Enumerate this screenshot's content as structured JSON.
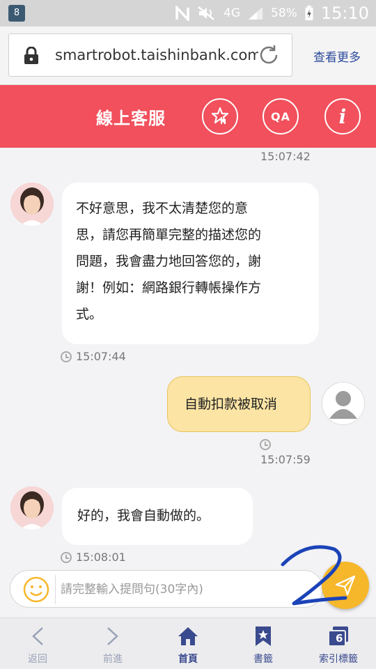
{
  "status_bar": {
    "badge": "8",
    "battery": "58%",
    "signal_type": "4G",
    "time": "15:10"
  },
  "browser": {
    "url": "smartrobot.taishinbank.com.tw",
    "more_label": "查看更多"
  },
  "header": {
    "title": "線上客服",
    "qa_label": "QA",
    "info_label": "i",
    "accent": "#f1505c"
  },
  "chat": {
    "top_timestamp": "15:07:42",
    "messages": [
      {
        "sender": "bot",
        "lines": [
          "不好意思，我不太清楚您的意",
          "思，請您再簡單完整的描述您的",
          "問題，我會盡力地回答您的，謝",
          "謝！例如：網路銀行轉帳操作方",
          "式。"
        ],
        "time": "15:07:44"
      },
      {
        "sender": "user",
        "lines": [
          "自動扣款被取消"
        ],
        "time": "15:07:59"
      },
      {
        "sender": "bot",
        "lines": [
          "好的，我會自動做的。"
        ],
        "time": "15:08:01"
      }
    ]
  },
  "input": {
    "placeholder": "請完整輸入提問句(30字內)",
    "value": ""
  },
  "bottom_nav": {
    "items": [
      {
        "label": "返回",
        "icon": "chevron-left-icon"
      },
      {
        "label": "前進",
        "icon": "chevron-right-icon"
      },
      {
        "label": "首頁",
        "icon": "home-icon"
      },
      {
        "label": "書籤",
        "icon": "bookmark-icon"
      },
      {
        "label": "索引標籤",
        "icon": "tabs-icon",
        "count": "6"
      }
    ]
  }
}
